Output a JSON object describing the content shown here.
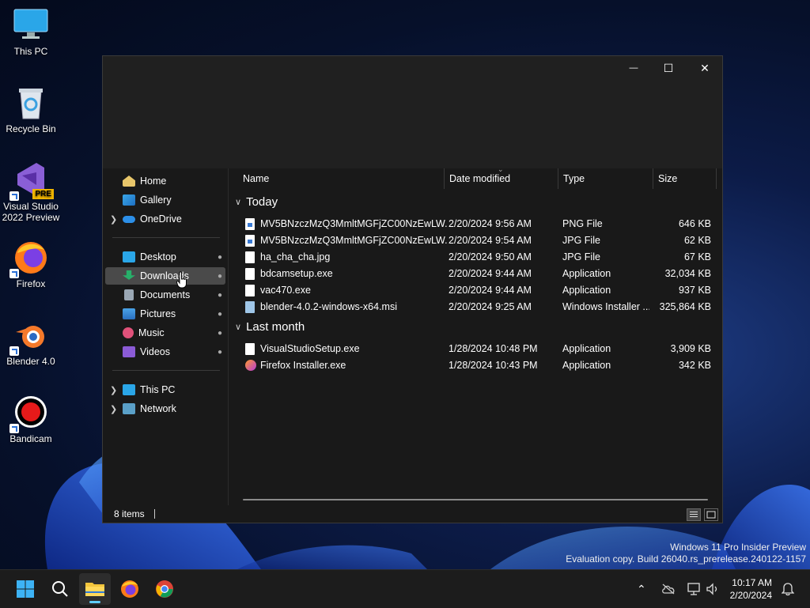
{
  "desktop": {
    "icons": [
      {
        "label": "This PC",
        "icon": "monitor-icon"
      },
      {
        "label": "Recycle Bin",
        "icon": "recycle-bin-icon"
      },
      {
        "label": "Visual Studio 2022 Preview",
        "icon": "visual-studio-icon",
        "badge": "PRE"
      },
      {
        "label": "Firefox",
        "icon": "firefox-icon"
      },
      {
        "label": "Blender 4.0",
        "icon": "blender-icon"
      },
      {
        "label": "Bandicam",
        "icon": "bandicam-icon"
      }
    ]
  },
  "window": {
    "controls": {
      "minimize": "—",
      "maximize": "☐",
      "close": "✕"
    },
    "nav": {
      "quick": [
        {
          "label": "Home",
          "icon": "home-icon"
        },
        {
          "label": "Gallery",
          "icon": "gallery-icon"
        },
        {
          "label": "OneDrive",
          "icon": "cloud-icon"
        }
      ],
      "pinned": [
        {
          "label": "Desktop",
          "icon": "desktop-folder-icon"
        },
        {
          "label": "Downloads",
          "icon": "downloads-folder-icon"
        },
        {
          "label": "Documents",
          "icon": "documents-folder-icon"
        },
        {
          "label": "Pictures",
          "icon": "pictures-folder-icon"
        },
        {
          "label": "Music",
          "icon": "music-folder-icon"
        },
        {
          "label": "Videos",
          "icon": "videos-folder-icon"
        }
      ],
      "devices": [
        {
          "label": "This PC",
          "icon": "computer-icon"
        },
        {
          "label": "Network",
          "icon": "network-icon"
        }
      ]
    },
    "columns": {
      "name": "Name",
      "date": "Date modified",
      "type": "Type",
      "size": "Size"
    },
    "groups": [
      {
        "title": "Today",
        "files": [
          {
            "name": "MV5BNzczMzQ3MmltMGFjZC00NzEwLW...",
            "date": "2/20/2024 9:56 AM",
            "type": "PNG File",
            "size": "646 KB",
            "icon": "image-file-icon"
          },
          {
            "name": "MV5BNzczMzQ3MmltMGFjZC00NzEwLW...",
            "date": "2/20/2024 9:54 AM",
            "type": "JPG File",
            "size": "62 KB",
            "icon": "image-file-icon"
          },
          {
            "name": "ha_cha_cha.jpg",
            "date": "2/20/2024 9:50 AM",
            "type": "JPG File",
            "size": "67 KB",
            "icon": "file-icon"
          },
          {
            "name": "bdcamsetup.exe",
            "date": "2/20/2024 9:44 AM",
            "type": "Application",
            "size": "32,034 KB",
            "icon": "file-icon"
          },
          {
            "name": "vac470.exe",
            "date": "2/20/2024 9:44 AM",
            "type": "Application",
            "size": "937 KB",
            "icon": "file-icon"
          },
          {
            "name": "blender-4.0.2-windows-x64.msi",
            "date": "2/20/2024 9:25 AM",
            "type": "Windows Installer ...",
            "size": "325,864 KB",
            "icon": "installer-icon"
          }
        ]
      },
      {
        "title": "Last month",
        "files": [
          {
            "name": "VisualStudioSetup.exe",
            "date": "1/28/2024 10:48 PM",
            "type": "Application",
            "size": "3,909 KB",
            "icon": "file-icon"
          },
          {
            "name": "Firefox Installer.exe",
            "date": "1/28/2024 10:43 PM",
            "type": "Application",
            "size": "342 KB",
            "icon": "firefox-installer-icon"
          }
        ]
      }
    ],
    "status": "8 items"
  },
  "watermark": {
    "line1": "Windows 11 Pro Insider Preview",
    "line2": "Evaluation copy. Build 26040.rs_prerelease.240122-1157"
  },
  "taskbar": {
    "apps": [
      "start-icon",
      "search-icon",
      "file-explorer-icon",
      "firefox-icon",
      "chrome-icon"
    ],
    "time": "10:17 AM",
    "date": "2/20/2024"
  },
  "colors": {
    "accent": "#60cdff",
    "window_bg": "#191919",
    "selected": "#4a4a4a"
  }
}
